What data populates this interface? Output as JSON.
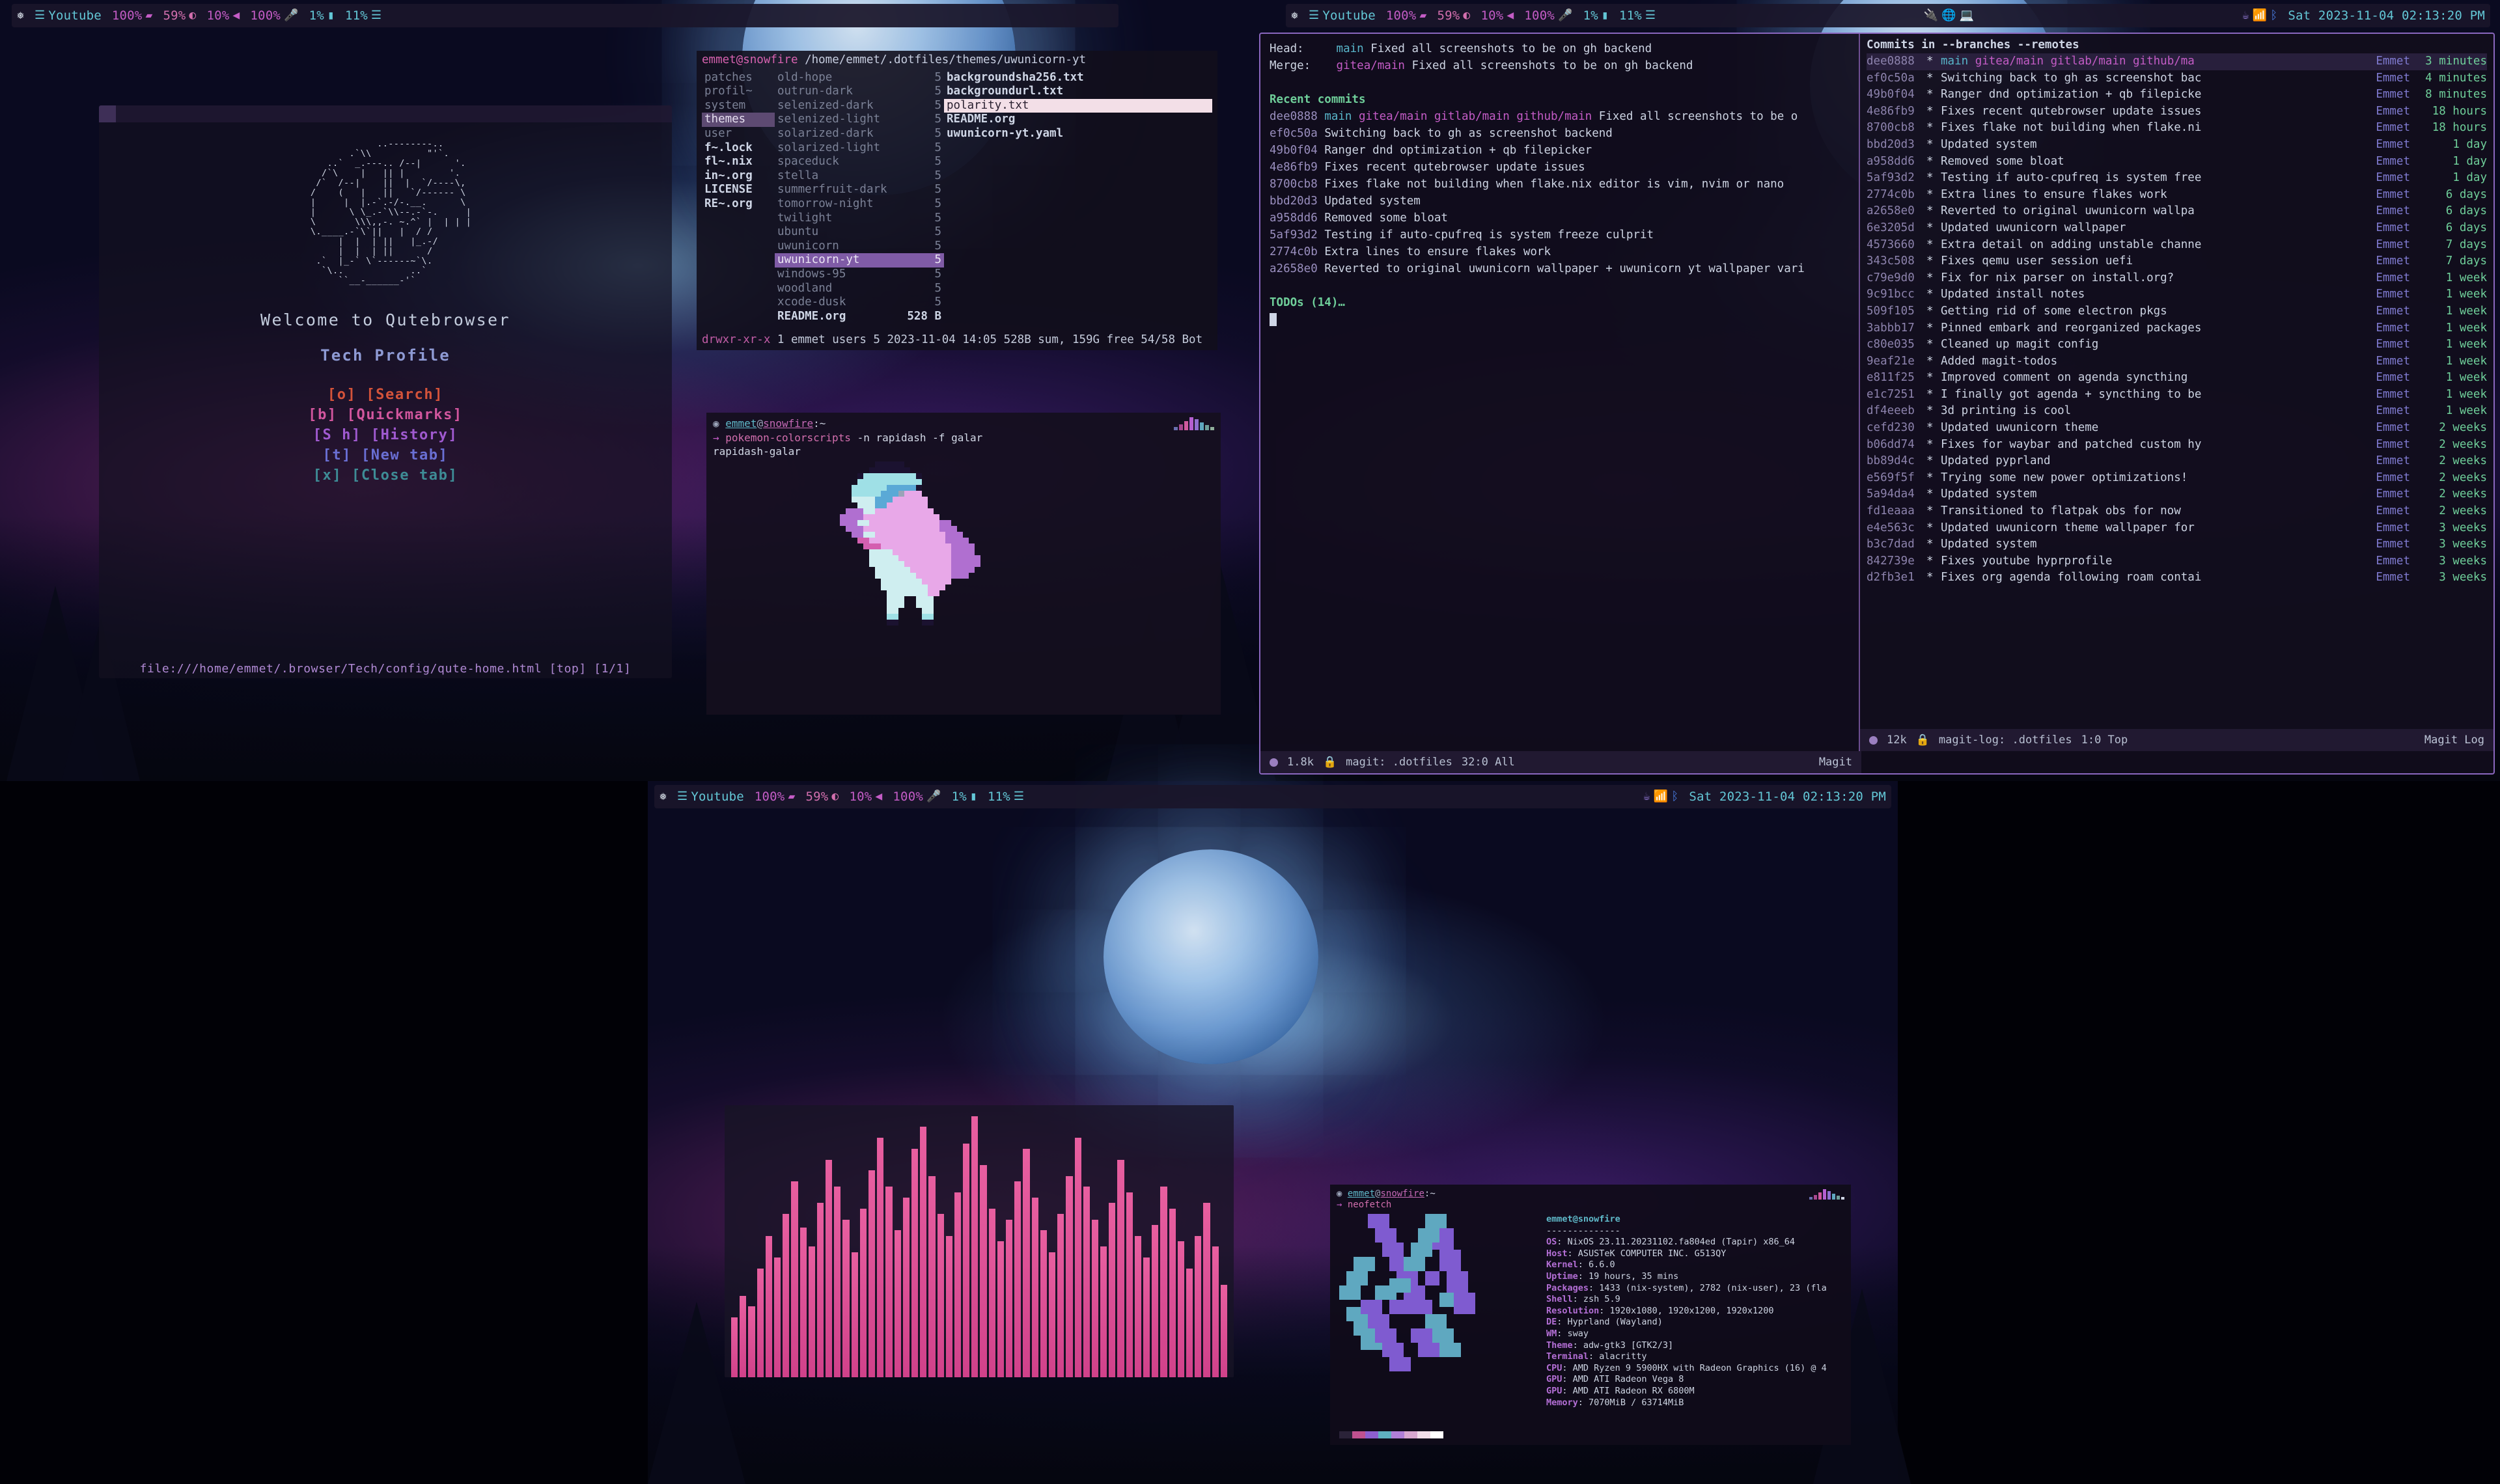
{
  "bars": {
    "left": {
      "logo_icon": "nix-snowflake-icon",
      "workspace_icon": "layers-icon",
      "workspace_label": "Youtube",
      "brightness": "100%",
      "brightness_icon": "battery-icon",
      "battery": "59%",
      "battery_icon": "contrast-icon",
      "volume": "10%",
      "volume_icon": "speaker-icon",
      "mic": "100%",
      "mic_icon": "microphone-icon",
      "cpu": "1%",
      "cpu_icon": "chip-icon",
      "mem": "11%",
      "mem_icon": "memory-icon"
    },
    "middle": {
      "logo_icon": "nix-snowflake-icon",
      "workspace_icon": "layers-icon",
      "workspace_label": "Youtube",
      "brightness": "100%",
      "battery": "59%",
      "volume": "10%",
      "mic": "100%",
      "cpu": "1%",
      "mem": "11%"
    },
    "tray": {
      "icons": [
        "usb-icon",
        "globe-icon",
        "laptop-icon"
      ],
      "right_icons": [
        "no-coffee-icon",
        "wifi-icon",
        "bluetooth-icon"
      ],
      "clock": "Sat 2023-11-04 02:13:20 PM"
    },
    "bottom": {
      "logo_icon": "nix-snowflake-icon",
      "workspace_icon": "layers-icon",
      "workspace_label": "Youtube",
      "brightness": "100%",
      "battery": "59%",
      "volume": "10%",
      "mic": "100%",
      "cpu": "1%",
      "mem": "11%",
      "right_icons": [
        "no-coffee-icon",
        "wifi-icon",
        "bluetooth-icon"
      ],
      "clock": "Sat 2023-11-04 02:13:20 PM"
    }
  },
  "qutebrowser": {
    "ascii_logo": "              ..--------..\n         .`\\\\          \"'`.\n     ..`  _.---.. /--|      '.\n    /`\\    |   || |        '.\n   /`  /--|    ||  |  `/----\\,\n  /    (   |   ||   `/------ \\\n  |     |  |.-`.-/-.__.      \\\n  |      \\ \\_.-`\\\\--.-`-.     |\n  \\       \\\\\\,,-. ~.^` |  | | |\n  \\.____.-`\\`||   |  / /\n       |  |  | ||   |_.-/\n       |  |  | ||      /\n   .`  |_-` \\`------~`\\.\n    `\\..            ..`\n       ``__-______-'`",
    "welcome": "Welcome to Qutebrowser",
    "profile": "Tech Profile",
    "links": [
      {
        "key": "[o]",
        "label": "[Search]",
        "color": "#d4533a"
      },
      {
        "key": "[b]",
        "label": "[Quickmarks]",
        "color": "#d2569e"
      },
      {
        "key": "[S h]",
        "label": "[History]",
        "color": "#a05ad0"
      },
      {
        "key": "[t]",
        "label": "[New tab]",
        "color": "#6a6fd4"
      },
      {
        "key": "[x]",
        "label": "[Close tab]",
        "color": "#3e8c96"
      }
    ],
    "status": "file:///home/emmet/.browser/Tech/config/qute-home.html [top] [1/1]"
  },
  "ranger": {
    "user": "emmet@snowfire",
    "path": "/home/emmet/.dotfiles/themes/uwunicorn-yt",
    "col1": [
      {
        "name": "patches",
        "style": "dim"
      },
      {
        "name": "profil~",
        "style": "dim"
      },
      {
        "name": "system",
        "style": "dim"
      },
      {
        "name": "themes",
        "style": "sel-dim"
      },
      {
        "name": "user",
        "style": "dim"
      },
      {
        "name": "f~.lock",
        "style": "bold"
      },
      {
        "name": "fl~.nix",
        "style": "bold"
      },
      {
        "name": "in~.org",
        "style": "bold"
      },
      {
        "name": "LICENSE",
        "style": "bold"
      },
      {
        "name": "RE~.org",
        "style": "bold"
      }
    ],
    "col2": [
      {
        "name": "old-hope",
        "size": "5",
        "style": "dim"
      },
      {
        "name": "outrun-dark",
        "size": "5",
        "style": "dim"
      },
      {
        "name": "selenized-dark",
        "size": "5",
        "style": "dim"
      },
      {
        "name": "selenized-light",
        "size": "5",
        "style": "dim"
      },
      {
        "name": "solarized-dark",
        "size": "5",
        "style": "dim"
      },
      {
        "name": "solarized-light",
        "size": "5",
        "style": "dim"
      },
      {
        "name": "spaceduck",
        "size": "5",
        "style": "dim"
      },
      {
        "name": "stella",
        "size": "5",
        "style": "dim"
      },
      {
        "name": "summerfruit-dark",
        "size": "5",
        "style": "dim"
      },
      {
        "name": "tomorrow-night",
        "size": "5",
        "style": "dim"
      },
      {
        "name": "twilight",
        "size": "5",
        "style": "dim"
      },
      {
        "name": "ubuntu",
        "size": "5",
        "style": "dim"
      },
      {
        "name": "uwunicorn",
        "size": "5",
        "style": "dim"
      },
      {
        "name": "uwunicorn-yt",
        "size": "5",
        "style": "sel-purple"
      },
      {
        "name": "windows-95",
        "size": "5",
        "style": "dim"
      },
      {
        "name": "woodland",
        "size": "5",
        "style": "dim"
      },
      {
        "name": "xcode-dusk",
        "size": "5",
        "style": "dim"
      },
      {
        "name": "README.org",
        "size": "528 B",
        "style": "bold"
      }
    ],
    "col3": [
      {
        "name": "backgroundsha256.txt",
        "style": "bold"
      },
      {
        "name": "backgroundurl.txt",
        "style": "bold"
      },
      {
        "name": "polarity.txt",
        "style": "sel-light"
      },
      {
        "name": "README.org",
        "style": "bold"
      },
      {
        "name": "uwunicorn-yt.yaml",
        "style": "bold"
      }
    ],
    "footer_perm": "drwxr-xr-x",
    "footer_rest": "1 emmet users 5 2023-11-04 14:05 528B sum, 159G free  54/58  Bot"
  },
  "pokemon": {
    "prompt_user": "emmet",
    "prompt_host": "snowfire",
    "prompt_tail": ":~",
    "arrow": "→",
    "command": "pokemon-colorscripts",
    "args": "-n rapidash -f galar",
    "output": "rapidash-galar"
  },
  "magit": {
    "head_label": "Head:",
    "head_branch": "main",
    "head_msg": "Fixed all screenshots to be on gh backend",
    "merge_label": "Merge:",
    "merge_branch": "gitea/main",
    "merge_msg": "Fixed all screenshots to be on gh backend",
    "section": "Recent commits",
    "commits": [
      {
        "sha": "dee0888",
        "refs": "main gitea/main gitlab/main github/main",
        "msg": "Fixed all screenshots to be o"
      },
      {
        "sha": "ef0c50a",
        "refs": "",
        "msg": "Switching back to gh as screenshot backend"
      },
      {
        "sha": "49b0f04",
        "refs": "",
        "msg": "Ranger dnd optimization + qb filepicker"
      },
      {
        "sha": "4e86fb9",
        "refs": "",
        "msg": "Fixes recent qutebrowser update issues"
      },
      {
        "sha": "8700cb8",
        "refs": "",
        "msg": "Fixes flake not building when flake.nix editor is vim, nvim or nano"
      },
      {
        "sha": "bbd20d3",
        "refs": "",
        "msg": "Updated system"
      },
      {
        "sha": "a958dd6",
        "refs": "",
        "msg": "Removed some bloat"
      },
      {
        "sha": "5af93d2",
        "refs": "",
        "msg": "Testing if auto-cpufreq is system freeze culprit"
      },
      {
        "sha": "2774c0b",
        "refs": "",
        "msg": "Extra lines to ensure flakes work"
      },
      {
        "sha": "a2658e0",
        "refs": "",
        "msg": "Reverted to original uwunicorn wallpaper + uwunicorn yt wallpaper vari"
      }
    ],
    "todos": "TODOs (14)…",
    "modeline": {
      "size": "1.8k",
      "buffer": "magit: .dotfiles",
      "pos": "32:0 All",
      "mode": "Magit"
    }
  },
  "magitlog": {
    "title": "Commits in --branches --remotes",
    "rows": [
      {
        "sha": "dee0888",
        "msg": "main gitea/main gitlab/main github/ma",
        "author": "Emmet",
        "time": "3 minutes",
        "current": true,
        "refs": true
      },
      {
        "sha": "ef0c50a",
        "msg": "Switching back to gh as screenshot bac",
        "author": "Emmet",
        "time": "4 minutes"
      },
      {
        "sha": "49b0f04",
        "msg": "Ranger dnd optimization + qb filepicke",
        "author": "Emmet",
        "time": "8 minutes"
      },
      {
        "sha": "4e86fb9",
        "msg": "Fixes recent qutebrowser update issues",
        "author": "Emmet",
        "time": "18 hours"
      },
      {
        "sha": "8700cb8",
        "msg": "Fixes flake not building when flake.ni",
        "author": "Emmet",
        "time": "18 hours"
      },
      {
        "sha": "bbd20d3",
        "msg": "Updated system",
        "author": "Emmet",
        "time": "1 day"
      },
      {
        "sha": "a958dd6",
        "msg": "Removed some bloat",
        "author": "Emmet",
        "time": "1 day"
      },
      {
        "sha": "5af93d2",
        "msg": "Testing if auto-cpufreq is system free",
        "author": "Emmet",
        "time": "1 day"
      },
      {
        "sha": "2774c0b",
        "msg": "Extra lines to ensure flakes work",
        "author": "Emmet",
        "time": "6 days"
      },
      {
        "sha": "a2658e0",
        "msg": "Reverted to original uwunicorn wallpa",
        "author": "Emmet",
        "time": "6 days"
      },
      {
        "sha": "6e3205d",
        "msg": "Updated uwunicorn wallpaper",
        "author": "Emmet",
        "time": "6 days"
      },
      {
        "sha": "4573660",
        "msg": "Extra detail on adding unstable channe",
        "author": "Emmet",
        "time": "7 days"
      },
      {
        "sha": "343c508",
        "msg": "Fixes qemu user session uefi",
        "author": "Emmet",
        "time": "7 days"
      },
      {
        "sha": "c79e9d0",
        "msg": "Fix for nix parser on install.org?",
        "author": "Emmet",
        "time": "1 week"
      },
      {
        "sha": "9c91bcc",
        "msg": "Updated install notes",
        "author": "Emmet",
        "time": "1 week"
      },
      {
        "sha": "509f105",
        "msg": "Getting rid of some electron pkgs",
        "author": "Emmet",
        "time": "1 week"
      },
      {
        "sha": "3abbb17",
        "msg": "Pinned embark and reorganized packages",
        "author": "Emmet",
        "time": "1 week"
      },
      {
        "sha": "c80e035",
        "msg": "Cleaned up magit config",
        "author": "Emmet",
        "time": "1 week"
      },
      {
        "sha": "9eaf21e",
        "msg": "Added magit-todos",
        "author": "Emmet",
        "time": "1 week"
      },
      {
        "sha": "e811f25",
        "msg": "Improved comment on agenda syncthing",
        "author": "Emmet",
        "time": "1 week"
      },
      {
        "sha": "e1c7251",
        "msg": "I finally got agenda + syncthing to be",
        "author": "Emmet",
        "time": "1 week"
      },
      {
        "sha": "df4eeeb",
        "msg": "3d printing is cool",
        "author": "Emmet",
        "time": "1 week"
      },
      {
        "sha": "cefd230",
        "msg": "Updated uwunicorn theme",
        "author": "Emmet",
        "time": "2 weeks"
      },
      {
        "sha": "b06dd74",
        "msg": "Fixes for waybar and patched custom hy",
        "author": "Emmet",
        "time": "2 weeks"
      },
      {
        "sha": "bb89d4c",
        "msg": "Updated pyprland",
        "author": "Emmet",
        "time": "2 weeks"
      },
      {
        "sha": "e569f5f",
        "msg": "Trying some new power optimizations!",
        "author": "Emmet",
        "time": "2 weeks"
      },
      {
        "sha": "5a94da4",
        "msg": "Updated system",
        "author": "Emmet",
        "time": "2 weeks"
      },
      {
        "sha": "fd1eaaa",
        "msg": "Transitioned to flatpak obs for now",
        "author": "Emmet",
        "time": "2 weeks"
      },
      {
        "sha": "e4e563c",
        "msg": "Updated uwunicorn theme wallpaper for",
        "author": "Emmet",
        "time": "3 weeks"
      },
      {
        "sha": "b3c7dad",
        "msg": "Updated system",
        "author": "Emmet",
        "time": "3 weeks"
      },
      {
        "sha": "842739e",
        "msg": "Fixes youtube hyprprofile",
        "author": "Emmet",
        "time": "3 weeks"
      },
      {
        "sha": "d2fb3e1",
        "msg": "Fixes org agenda following roam contai",
        "author": "Emmet",
        "time": "3 weeks"
      }
    ],
    "modeline": {
      "size": "12k",
      "buffer": "magit-log: .dotfiles",
      "pos": "1:0 Top",
      "mode": "Magit Log"
    }
  },
  "neofetch": {
    "prompt_user": "emmet",
    "prompt_host": "snowfire",
    "prompt_tail": ":~",
    "command": "neofetch",
    "title": "emmet@snowfire",
    "rule": "--------------",
    "fields": [
      {
        "k": "OS",
        "v": "NixOS 23.11.20231102.fa804ed (Tapir) x86_64"
      },
      {
        "k": "Host",
        "v": "ASUSTeK COMPUTER INC. G513QY"
      },
      {
        "k": "Kernel",
        "v": "6.6.0"
      },
      {
        "k": "Uptime",
        "v": "19 hours, 35 mins"
      },
      {
        "k": "Packages",
        "v": "1433 (nix-system), 2782 (nix-user), 23 (fla"
      },
      {
        "k": "Shell",
        "v": "zsh 5.9"
      },
      {
        "k": "Resolution",
        "v": "1920x1080, 1920x1200, 1920x1200"
      },
      {
        "k": "DE",
        "v": "Hyprland (Wayland)"
      },
      {
        "k": "WM",
        "v": "sway"
      },
      {
        "k": "Theme",
        "v": "adw-gtk3 [GTK2/3]"
      },
      {
        "k": "Terminal",
        "v": "alacritty"
      },
      {
        "k": "CPU",
        "v": "AMD Ryzen 9 5900HX with Radeon Graphics (16) @ 4"
      },
      {
        "k": "GPU",
        "v": "AMD ATI Radeon Vega 8"
      },
      {
        "k": "GPU",
        "v": "AMD ATI Radeon RX 6800M"
      },
      {
        "k": "Memory",
        "v": "7070MiB / 63714MiB"
      }
    ],
    "swatches": [
      "#2a2238",
      "#c0518f",
      "#8d5fd0",
      "#5fb0c0",
      "#b07fd8",
      "#d8a8d0",
      "#f0dde8",
      "#ffffff"
    ]
  },
  "colors": {
    "accent_pink": "#d36fae",
    "accent_purple": "#9a7fe0",
    "accent_cyan": "#63c7d6",
    "accent_green": "#6fcf9a",
    "bar_bg": "#1a162a"
  }
}
